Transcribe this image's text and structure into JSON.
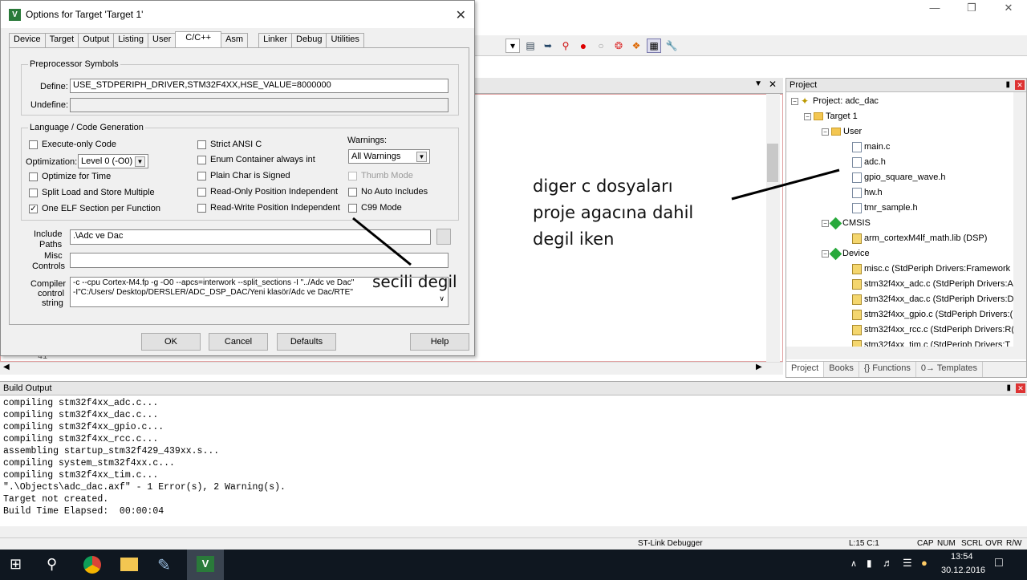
{
  "dialog": {
    "title": "Options for Target 'Target 1'",
    "tabs": [
      "Device",
      "Target",
      "Output",
      "Listing",
      "User",
      "C/C++",
      "Asm",
      "Linker",
      "Debug",
      "Utilities"
    ],
    "selected_tab": "C/C++",
    "preprocessor": {
      "legend": "Preprocessor Symbols",
      "define_label": "Define:",
      "define_value": "USE_STDPERIPH_DRIVER,STM32F4XX,HSE_VALUE=8000000",
      "undefine_label": "Undefine:",
      "undefine_value": ""
    },
    "language": {
      "legend": "Language / Code Generation",
      "execute_only": "Execute-only Code",
      "optimization_label": "Optimization:",
      "optimization_value": "Level 0 (-O0)",
      "optimize_time": "Optimize for Time",
      "split_load": "Split Load and Store Multiple",
      "one_elf": "One ELF Section per Function",
      "strict_ansi": "Strict ANSI C",
      "enum_container": "Enum Container always int",
      "plain_char": "Plain Char is Signed",
      "ro_pos": "Read-Only Position Independent",
      "rw_pos": "Read-Write Position Independent",
      "warnings_label": "Warnings:",
      "warnings_value": "All Warnings",
      "thumb_mode": "Thumb Mode",
      "no_auto": "No Auto Includes",
      "c99": "C99 Mode"
    },
    "include_label_1": "Include",
    "include_label_2": "Paths",
    "include_value": ".\\Adc ve Dac",
    "misc_label_1": "Misc",
    "misc_label_2": "Controls",
    "misc_value": "",
    "compiler_label_1": "Compiler",
    "compiler_label_2": "control",
    "compiler_label_3": "string",
    "compiler_line1": "-c --cpu Cortex-M4.fp -g -O0 --apcs=interwork --split_sections -I \"../Adc ve Dac\"",
    "compiler_line2": "-I\"C:/Users/               Desktop/DERSLER/ADC_DSP_DAC/Yeni klasör/Adc ve Dac/RTE\"",
    "buttons": {
      "ok": "OK",
      "cancel": "Cancel",
      "defaults": "Defaults",
      "help": "Help"
    }
  },
  "editor": {
    "line_number": "41"
  },
  "project": {
    "title": "Project",
    "root": "Project: adc_dac",
    "target": "Target 1",
    "user_folder": "User",
    "user_files": [
      "main.c",
      "adc.h",
      "gpio_square_wave.h",
      "hw.h",
      "tmr_sample.h"
    ],
    "cmsis": "CMSIS",
    "cmsis_file": "arm_cortexM4lf_math.lib (DSP)",
    "device": "Device",
    "device_files": [
      "misc.c (StdPeriph Drivers:Framework",
      "stm32f4xx_adc.c (StdPeriph Drivers:A",
      "stm32f4xx_dac.c (StdPeriph Drivers:D",
      "stm32f4xx_gpio.c (StdPeriph Drivers:(",
      "stm32f4xx_rcc.c (StdPeriph Drivers:R(",
      "stm32f4xx_tim.c (StdPeriph Drivers:T"
    ],
    "tabs": [
      "Project",
      "Books",
      "{} Functions",
      "0→ Templates"
    ]
  },
  "build": {
    "title": "Build Output",
    "text": "compiling stm32f4xx_adc.c...\ncompiling stm32f4xx_dac.c...\ncompiling stm32f4xx_gpio.c...\ncompiling stm32f4xx_rcc.c...\nassembling startup_stm32f429_439xx.s...\ncompiling system_stm32f4xx.c...\ncompiling stm32f4xx_tim.c...\n\".\\Objects\\adc_dac.axf\" - 1 Error(s), 2 Warning(s).\nTarget not created.\nBuild Time Elapsed:  00:00:04"
  },
  "status": {
    "debugger": "ST-Link Debugger",
    "position": "L:15 C:1",
    "indicators": [
      "CAP",
      "NUM",
      "SCRL",
      "OVR",
      "R/W"
    ]
  },
  "taskbar": {
    "time": "13:54",
    "date": "30.12.2016"
  },
  "annotations": {
    "files_note_1": "diger c dosyaları",
    "files_note_2": "proje agacına dahil",
    "files_note_3": "degil iken",
    "checkbox_note": "secili degil"
  }
}
